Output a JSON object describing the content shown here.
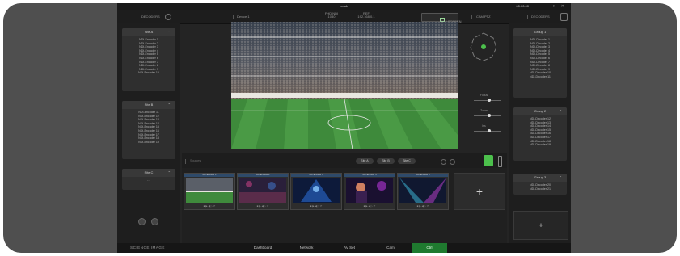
{
  "window": {
    "title": "Leads",
    "time": "00:00:00",
    "controls": [
      "—",
      "□",
      "✕"
    ]
  },
  "header": {
    "decoders_left": "DECODERS",
    "device": "Device 1",
    "info1": [
      "FHD NDI",
      "1080"
    ],
    "info2": [
      "REF",
      "192.168.0.1"
    ],
    "fullscreen": "FULLSCREEN",
    "cam_ptz": "CAM PTZ",
    "decoders_right": "DECODERS"
  },
  "left_sites": [
    {
      "title": "Site A",
      "items": [
        "NDI-Encoder 1",
        "NDI-Encoder 2",
        "NDI-Encoder 3",
        "NDI-Encoder 4",
        "NDI-Encoder 5",
        "NDI-Encoder 6",
        "NDI-Encoder 7",
        "NDI-Encoder 8",
        "NDI-Encoder 9",
        "NDI-Encoder 10"
      ]
    },
    {
      "title": "Site B",
      "items": [
        "NDI-Encoder 11",
        "NDI-Encoder 12",
        "NDI-Encoder 13",
        "NDI-Encoder 14",
        "NDI-Encoder 15",
        "NDI-Encoder 16",
        "NDI-Encoder 17",
        "NDI-Encoder 18",
        "NDI-Encoder 19"
      ]
    },
    {
      "title": "Site C",
      "items": [
        "- -"
      ]
    }
  ],
  "right_groups": [
    {
      "title": "Group 1",
      "items": [
        "NDI-Decoder 1",
        "NDI-Decoder 2",
        "NDI-Decoder 3",
        "NDI-Decoder 4",
        "NDI-Decoder 5",
        "NDI-Decoder 6",
        "NDI-Decoder 7",
        "NDI-Decoder 8",
        "NDI-Decoder 9",
        "NDI-Decoder 10",
        "NDI-Decoder 11"
      ]
    },
    {
      "title": "Group 2",
      "items": [
        "NDI-Decoder 12",
        "NDI-Decoder 13",
        "NDI-Decoder 14",
        "NDI-Decoder 15",
        "NDI-Decoder 16",
        "NDI-Decoder 17",
        "NDI-Decoder 18",
        "NDI-Decoder 19"
      ]
    },
    {
      "title": "Group 3",
      "items": [
        "NDI-Decoder 20",
        "NDI-Decoder 21"
      ]
    }
  ],
  "ptz": {
    "labels": [
      "Focus",
      "Zoom",
      "Iris"
    ],
    "levels": [
      0.55,
      0.55,
      0.55
    ]
  },
  "source_bar": {
    "label": "Sources",
    "sites": [
      "Site A",
      "Site B",
      "Site C"
    ]
  },
  "thumbnails": [
    {
      "caption": "NDI-Encoder 1",
      "theme": "stadium"
    },
    {
      "caption": "NDI-Encoder 2",
      "theme": "concert"
    },
    {
      "caption": "NDI-Encoder 3",
      "theme": "blue-stage"
    },
    {
      "caption": "NDI-Encoder 4",
      "theme": "performer"
    },
    {
      "caption": "NDI-Encoder 5",
      "theme": "lights"
    }
  ],
  "add_label": "+",
  "tabs": {
    "brand": "SCIENCE IMAGE",
    "items": [
      "Dashboard",
      "Network",
      "AV Set",
      "Cam",
      "Ctrl"
    ],
    "active": "Ctrl"
  },
  "colors": {
    "accent_green": "#4cc04c",
    "active_tab": "#1f7a2f",
    "thumb_caption": "#2e4a6a"
  }
}
